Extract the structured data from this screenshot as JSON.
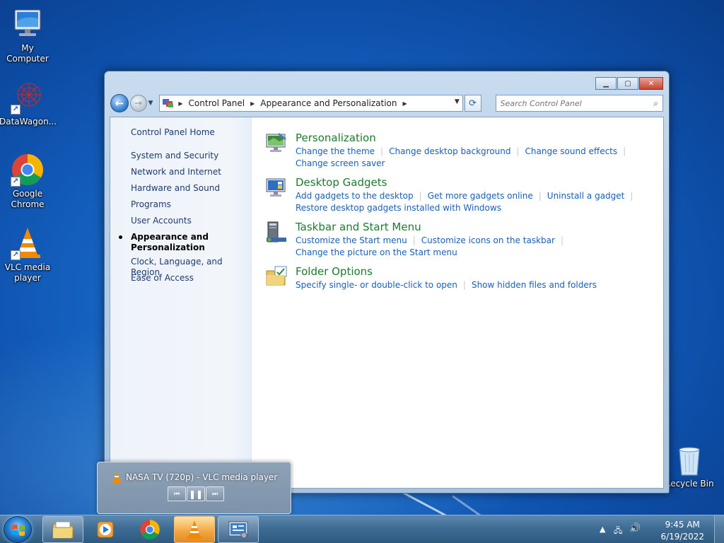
{
  "desktop": {
    "icons": [
      {
        "label": "My Computer",
        "icon": "computer-icon"
      },
      {
        "label": "DataWagon...",
        "icon": "datawagon-icon"
      },
      {
        "label": "Google Chrome",
        "icon": "chrome-icon"
      },
      {
        "label": "VLC media player",
        "icon": "vlc-icon"
      },
      {
        "label": "Recycle Bin",
        "icon": "recycle-bin-icon"
      }
    ]
  },
  "window": {
    "breadcrumbs": [
      "Control Panel",
      "Appearance and Personalization"
    ],
    "search_placeholder": "Search Control Panel",
    "left_pane": {
      "home": "Control Panel Home",
      "items": [
        "System and Security",
        "Network and Internet",
        "Hardware and Sound",
        "Programs",
        "User Accounts",
        "Appearance and Personalization",
        "Clock, Language, and Region",
        "Ease of Access"
      ]
    },
    "categories": [
      {
        "title": "Personalization",
        "icon": "personalization-icon",
        "links": [
          "Change the theme",
          "Change desktop background",
          "Change sound effects",
          "Change screen saver"
        ]
      },
      {
        "title": "Desktop Gadgets",
        "icon": "gadgets-icon",
        "links": [
          "Add gadgets to the desktop",
          "Get more gadgets online",
          "Uninstall a gadget",
          "Restore desktop gadgets installed with Windows"
        ]
      },
      {
        "title": "Taskbar and Start Menu",
        "icon": "taskbar-icon",
        "links": [
          "Customize the Start menu",
          "Customize icons on the taskbar",
          "Change the picture on the Start menu"
        ]
      },
      {
        "title": "Folder Options",
        "icon": "folder-options-icon",
        "links": [
          "Specify single- or double-click to open",
          "Show hidden files and folders"
        ]
      }
    ]
  },
  "vlc_preview": {
    "title": "NASA TV (720p) - VLC media player",
    "controls": [
      "previous",
      "pause",
      "next"
    ]
  },
  "taskbar": {
    "buttons": [
      "explorer",
      "media-player",
      "chrome",
      "vlc",
      "control-panel"
    ],
    "active": "vlc",
    "clock": {
      "time": "9:45 AM",
      "date": "6/19/2022"
    }
  },
  "colors": {
    "desktop": "#1766c6",
    "link": "#1a5fb4",
    "category_title": "#1e7a2e",
    "taskbar": "#3e6c94"
  }
}
